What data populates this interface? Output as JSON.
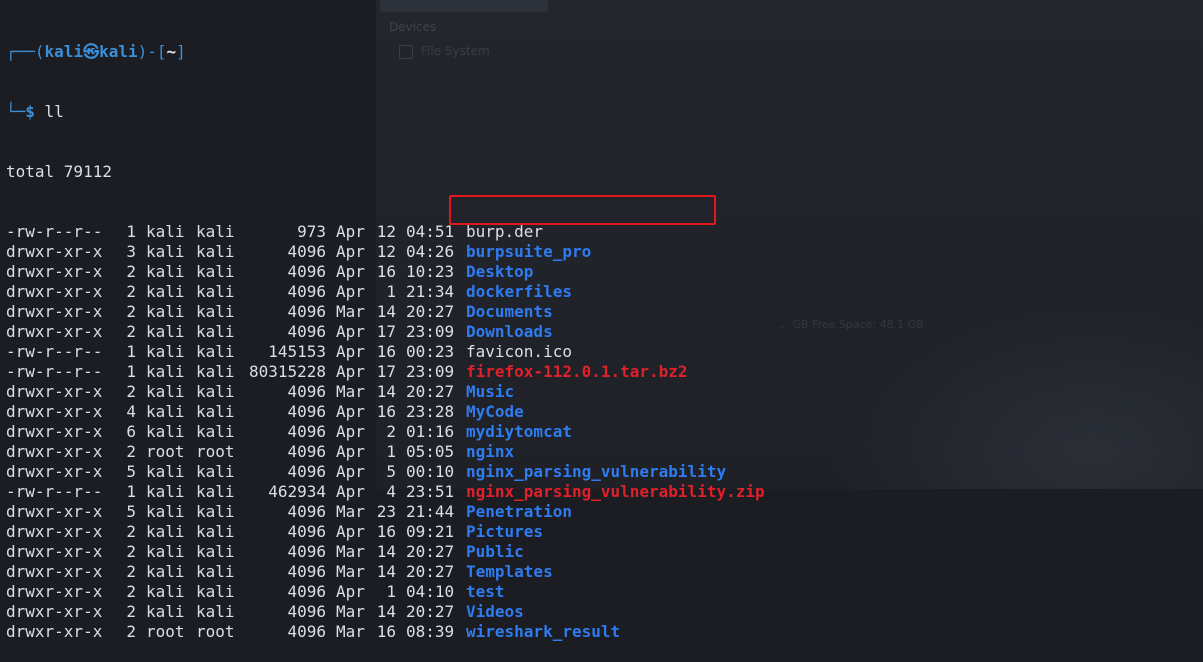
{
  "background": {
    "devices_label": "Devices",
    "filesystem_label": "File System",
    "free_space_text": "… GB Free Space: 48.1 GB"
  },
  "prompt": {
    "corner_top": "┌──",
    "open_paren": "(",
    "user": "kali",
    "at_symbol": "㉿",
    "host": "kali",
    "close_paren": ")-[",
    "path": "~",
    "close_bracket": "]",
    "corner_bottom": "└─",
    "dollar": "$",
    "command": "ll"
  },
  "total_line": "total 79112",
  "colors": {
    "directory": "#2f7bf0",
    "archive": "#e0202a",
    "regular_file": "#dcdfe4",
    "prompt_accent": "#3a8fd8",
    "highlight_box": "#e3161c",
    "terminal_bg": "#1b1d23"
  },
  "entries": [
    {
      "perm": "-rw-r--r--",
      "links": "1",
      "owner": "kali",
      "group": "kali",
      "size": "973",
      "month": "Apr",
      "day": "12",
      "time": "04:51",
      "name": "burp.der",
      "type": "file"
    },
    {
      "perm": "drwxr-xr-x",
      "links": "3",
      "owner": "kali",
      "group": "kali",
      "size": "4096",
      "month": "Apr",
      "day": "12",
      "time": "04:26",
      "name": "burpsuite_pro",
      "type": "dir"
    },
    {
      "perm": "drwxr-xr-x",
      "links": "2",
      "owner": "kali",
      "group": "kali",
      "size": "4096",
      "month": "Apr",
      "day": "16",
      "time": "10:23",
      "name": "Desktop",
      "type": "dir"
    },
    {
      "perm": "drwxr-xr-x",
      "links": "2",
      "owner": "kali",
      "group": "kali",
      "size": "4096",
      "month": "Apr",
      "day": "1",
      "time": "21:34",
      "name": "dockerfiles",
      "type": "dir"
    },
    {
      "perm": "drwxr-xr-x",
      "links": "2",
      "owner": "kali",
      "group": "kali",
      "size": "4096",
      "month": "Mar",
      "day": "14",
      "time": "20:27",
      "name": "Documents",
      "type": "dir"
    },
    {
      "perm": "drwxr-xr-x",
      "links": "2",
      "owner": "kali",
      "group": "kali",
      "size": "4096",
      "month": "Apr",
      "day": "17",
      "time": "23:09",
      "name": "Downloads",
      "type": "dir"
    },
    {
      "perm": "-rw-r--r--",
      "links": "1",
      "owner": "kali",
      "group": "kali",
      "size": "145153",
      "month": "Apr",
      "day": "16",
      "time": "00:23",
      "name": "favicon.ico",
      "type": "file"
    },
    {
      "perm": "-rw-r--r--",
      "links": "1",
      "owner": "kali",
      "group": "kali",
      "size": "80315228",
      "month": "Apr",
      "day": "17",
      "time": "23:09",
      "name": "firefox-112.0.1.tar.bz2",
      "type": "arch",
      "highlighted": true
    },
    {
      "perm": "drwxr-xr-x",
      "links": "2",
      "owner": "kali",
      "group": "kali",
      "size": "4096",
      "month": "Mar",
      "day": "14",
      "time": "20:27",
      "name": "Music",
      "type": "dir"
    },
    {
      "perm": "drwxr-xr-x",
      "links": "4",
      "owner": "kali",
      "group": "kali",
      "size": "4096",
      "month": "Apr",
      "day": "16",
      "time": "23:28",
      "name": "MyCode",
      "type": "dir"
    },
    {
      "perm": "drwxr-xr-x",
      "links": "6",
      "owner": "kali",
      "group": "kali",
      "size": "4096",
      "month": "Apr",
      "day": "2",
      "time": "01:16",
      "name": "mydiytomcat",
      "type": "dir"
    },
    {
      "perm": "drwxr-xr-x",
      "links": "2",
      "owner": "root",
      "group": "root",
      "size": "4096",
      "month": "Apr",
      "day": "1",
      "time": "05:05",
      "name": "nginx",
      "type": "dir"
    },
    {
      "perm": "drwxr-xr-x",
      "links": "5",
      "owner": "kali",
      "group": "kali",
      "size": "4096",
      "month": "Apr",
      "day": "5",
      "time": "00:10",
      "name": "nginx_parsing_vulnerability",
      "type": "dir"
    },
    {
      "perm": "-rw-r--r--",
      "links": "1",
      "owner": "kali",
      "group": "kali",
      "size": "462934",
      "month": "Apr",
      "day": "4",
      "time": "23:51",
      "name": "nginx_parsing_vulnerability.zip",
      "type": "arch"
    },
    {
      "perm": "drwxr-xr-x",
      "links": "5",
      "owner": "kali",
      "group": "kali",
      "size": "4096",
      "month": "Mar",
      "day": "23",
      "time": "21:44",
      "name": "Penetration",
      "type": "dir"
    },
    {
      "perm": "drwxr-xr-x",
      "links": "2",
      "owner": "kali",
      "group": "kali",
      "size": "4096",
      "month": "Apr",
      "day": "16",
      "time": "09:21",
      "name": "Pictures",
      "type": "dir"
    },
    {
      "perm": "drwxr-xr-x",
      "links": "2",
      "owner": "kali",
      "group": "kali",
      "size": "4096",
      "month": "Mar",
      "day": "14",
      "time": "20:27",
      "name": "Public",
      "type": "dir"
    },
    {
      "perm": "drwxr-xr-x",
      "links": "2",
      "owner": "kali",
      "group": "kali",
      "size": "4096",
      "month": "Mar",
      "day": "14",
      "time": "20:27",
      "name": "Templates",
      "type": "dir"
    },
    {
      "perm": "drwxr-xr-x",
      "links": "2",
      "owner": "kali",
      "group": "kali",
      "size": "4096",
      "month": "Apr",
      "day": "1",
      "time": "04:10",
      "name": "test",
      "type": "dir"
    },
    {
      "perm": "drwxr-xr-x",
      "links": "2",
      "owner": "kali",
      "group": "kali",
      "size": "4096",
      "month": "Mar",
      "day": "14",
      "time": "20:27",
      "name": "Videos",
      "type": "dir"
    },
    {
      "perm": "drwxr-xr-x",
      "links": "2",
      "owner": "root",
      "group": "root",
      "size": "4096",
      "month": "Mar",
      "day": "16",
      "time": "08:39",
      "name": "wireshark_result",
      "type": "dir"
    }
  ]
}
